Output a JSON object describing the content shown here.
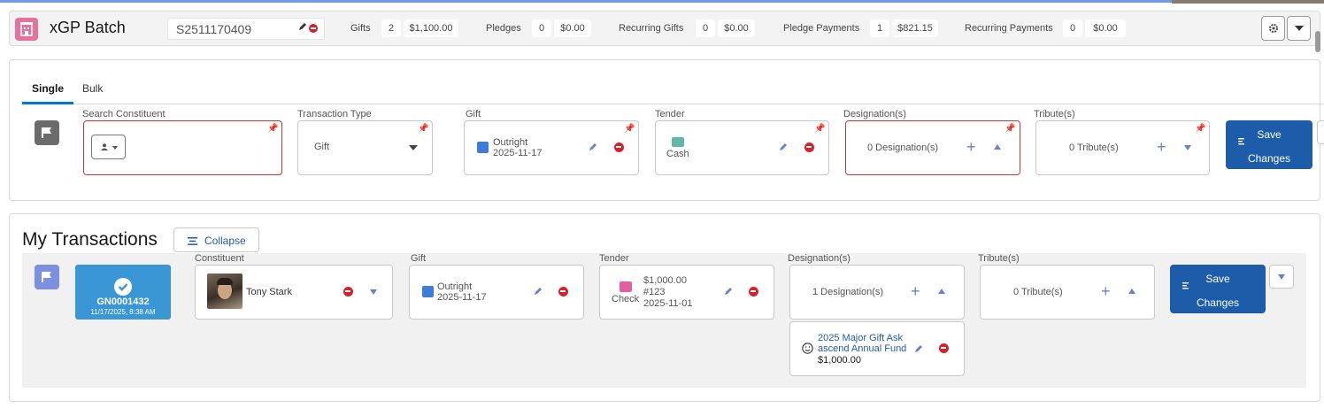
{
  "header": {
    "app_title": "xGP Batch",
    "batch_number": "S2511170409",
    "stats": [
      {
        "label": "Gifts",
        "count": "2",
        "amount": "$1,100.00"
      },
      {
        "label": "Pledges",
        "count": "0",
        "amount": "$0.00"
      },
      {
        "label": "Recurring Gifts",
        "count": "0",
        "amount": "$0.00"
      },
      {
        "label": "Pledge Payments",
        "count": "1",
        "amount": "$821.15"
      },
      {
        "label": "Recurring Payments",
        "count": "0",
        "amount": "$0.00"
      }
    ]
  },
  "tabs": {
    "single": "Single",
    "bulk": "Bulk"
  },
  "entry": {
    "search_constituent_label": "Search Constituent",
    "transaction_type_label": "Transaction Type",
    "transaction_type_value": "Gift",
    "gift_label": "Gift",
    "gift_type": "Outright",
    "gift_date": "2025-11-17",
    "tender_label": "Tender",
    "tender_value": "Cash",
    "designations_label": "Designation(s)",
    "designations_value": "0 Designation(s)",
    "tribute_label": "Tribute(s)",
    "tribute_value": "0 Tribute(s)",
    "save_line1": "Save",
    "save_line2": "Changes"
  },
  "transactions": {
    "title": "My Transactions",
    "collapse_label": "Collapse",
    "row": {
      "gift_number": "GN0001432",
      "timestamp": "11/17/2025, 8:38 AM",
      "constituent_label": "Constituent",
      "constituent_name": "Tony Stark",
      "gift_label": "Gift",
      "gift_type": "Outright",
      "gift_date": "2025-11-17",
      "tender_label": "Tender",
      "tender_amount": "$1,000.00",
      "tender_ref": "#123",
      "tender_date": "2025-11-01",
      "tender_type": "Check",
      "designations_label": "Designation(s)",
      "designations_value": "1 Designation(s)",
      "designation_line1": "2025 Major Gift Ask",
      "designation_line2": "ascend Annual Fund",
      "designation_amount": "$1,000.00",
      "tribute_label": "Tribute(s)",
      "tribute_value": "0 Tribute(s)",
      "save_line1": "Save",
      "save_line2": "Changes"
    }
  },
  "colors": {
    "accent": "#1d5ca8",
    "app_icon": "#e3739c",
    "badge": "#3b96d6",
    "remove": "#d6202c"
  }
}
